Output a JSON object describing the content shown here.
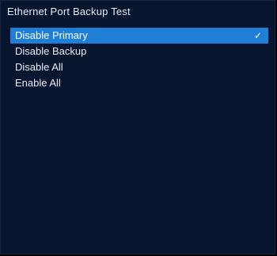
{
  "window": {
    "title": "Ethernet Port Backup Test"
  },
  "menu": {
    "items": [
      {
        "label": "Disable Primary",
        "selected": true
      },
      {
        "label": "Disable Backup",
        "selected": false
      },
      {
        "label": "Disable All",
        "selected": false
      },
      {
        "label": "Enable All",
        "selected": false
      }
    ],
    "check_icon": "checkmark-icon"
  },
  "colors": {
    "background": "#08152e",
    "selection": "#1f7fd6",
    "text": "#e8ecf4"
  }
}
